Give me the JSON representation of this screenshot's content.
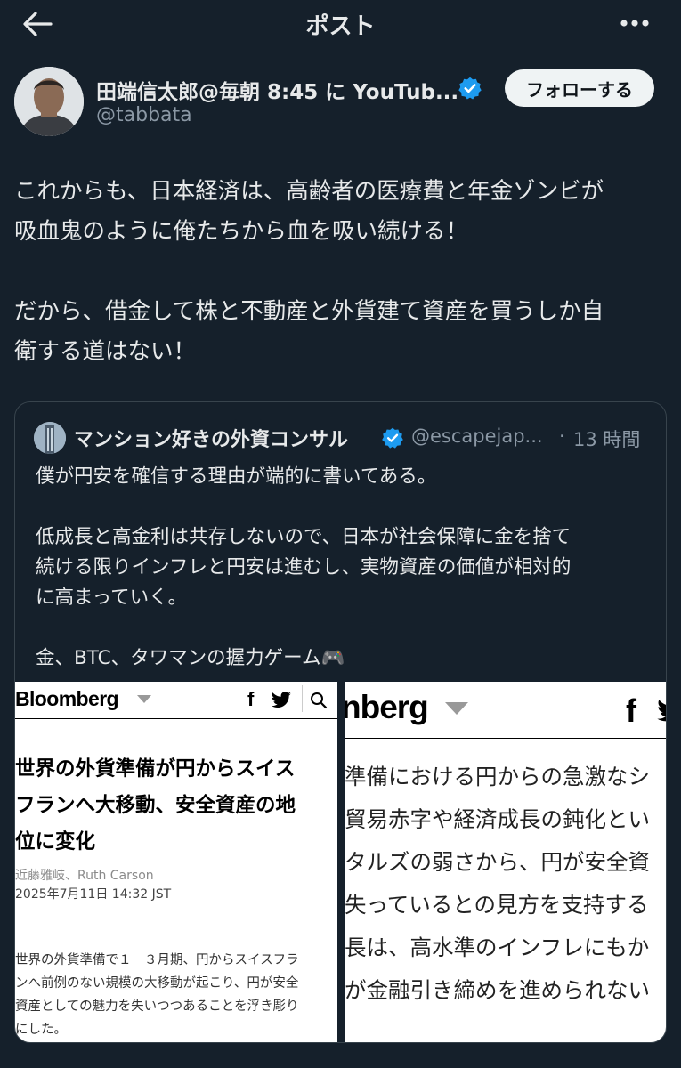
{
  "header": {
    "title": "ポスト",
    "back_icon": "arrow-left-icon",
    "more_icon": "more-horizontal-icon"
  },
  "author": {
    "name": "田端信太郎@毎朝 8:45 に YouTub...",
    "handle": "@tabbata",
    "follow_label": "フォローする",
    "verified_color": "#1d9bf0"
  },
  "post": {
    "lines_1": [
      "これからも、日本経済は、高齢者の医療費と年金ゾンビが",
      "吸血鬼のように俺たちから血を吸い続ける！"
    ],
    "lines_2": [
      "だから、借金して株と不動産と外貨建て資産を買うしか自",
      "衛する道はない！"
    ]
  },
  "quote": {
    "name": "マンション好きの外資コンサル",
    "handle": "@escapejap...",
    "separator": "·",
    "time": "13 時間",
    "para_1": [
      "僕が円安を確信する理由が端的に書いてある。"
    ],
    "para_2": [
      "低成長と高金利は共存しないので、日本が社会保障に金を捨て",
      "続ける限りインフレと円安は進むし、実物資産の価値が相対的",
      "に高まっていく。"
    ],
    "para_3": [
      "金、BTC、タワマンの握力ゲーム🎮"
    ]
  },
  "image_left": {
    "logo": "Bloomberg",
    "fb": "f",
    "headline": [
      "世界の外貨準備が円からスイス",
      "フランへ大移動、安全資産の地",
      "位に変化"
    ],
    "byline": "近藤雅岐、Ruth Carson",
    "date": "2025年7月11日 14:32 JST",
    "body": [
      "世界の外貨準備で１－３月期、円からスイスフラ",
      "ンへ前例のない規模の大移動が起こり、円が安全",
      "資産としての魅力を失いつつあることを浮き彫り",
      "にした。"
    ]
  },
  "image_right": {
    "logo": "nberg",
    "fb": "f",
    "body": [
      "準備における円からの急激なシ",
      "貿易赤字や経済成長の鈍化とい",
      "タルズの弱さから、円が安全資",
      "失っているとの見方を支持する",
      "長は、高水準のインフレにもか",
      "が金融引き締めを進められない"
    ]
  }
}
